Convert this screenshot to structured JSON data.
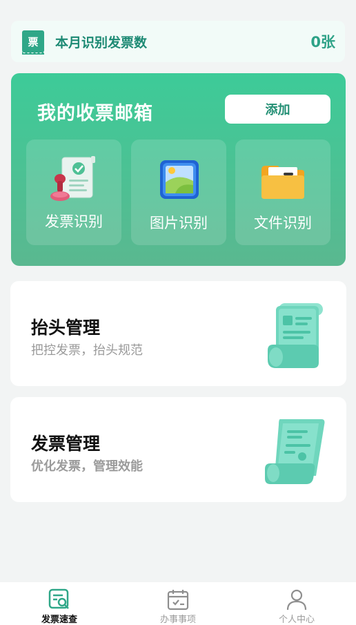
{
  "stat": {
    "icon_char": "票",
    "label": "本月识别发票数",
    "value": "0张"
  },
  "mailbox": {
    "title": "我的收票邮箱",
    "add_label": "添加",
    "tiles": [
      {
        "label": "发票识别",
        "icon": "invoice-stamp-icon"
      },
      {
        "label": "图片识别",
        "icon": "picture-icon"
      },
      {
        "label": "文件识别",
        "icon": "folder-icon"
      }
    ]
  },
  "cards": [
    {
      "title": "抬头管理",
      "subtitle": "把控发票，抬头规范",
      "icon": "scroll-document-icon"
    },
    {
      "title": "发票管理",
      "subtitle": "优化发票，管理效能",
      "icon": "invoice-scroll-icon"
    }
  ],
  "nav": {
    "items": [
      {
        "label": "发票速查",
        "icon": "invoice-search-icon",
        "active": true
      },
      {
        "label": "办事事项",
        "icon": "calendar-check-icon",
        "active": false
      },
      {
        "label": "个人中心",
        "icon": "person-icon",
        "active": false
      }
    ]
  },
  "colors": {
    "accent": "#2fa788",
    "card_gradient_top": "#3dcb98",
    "card_gradient_bottom": "#5ab890"
  }
}
